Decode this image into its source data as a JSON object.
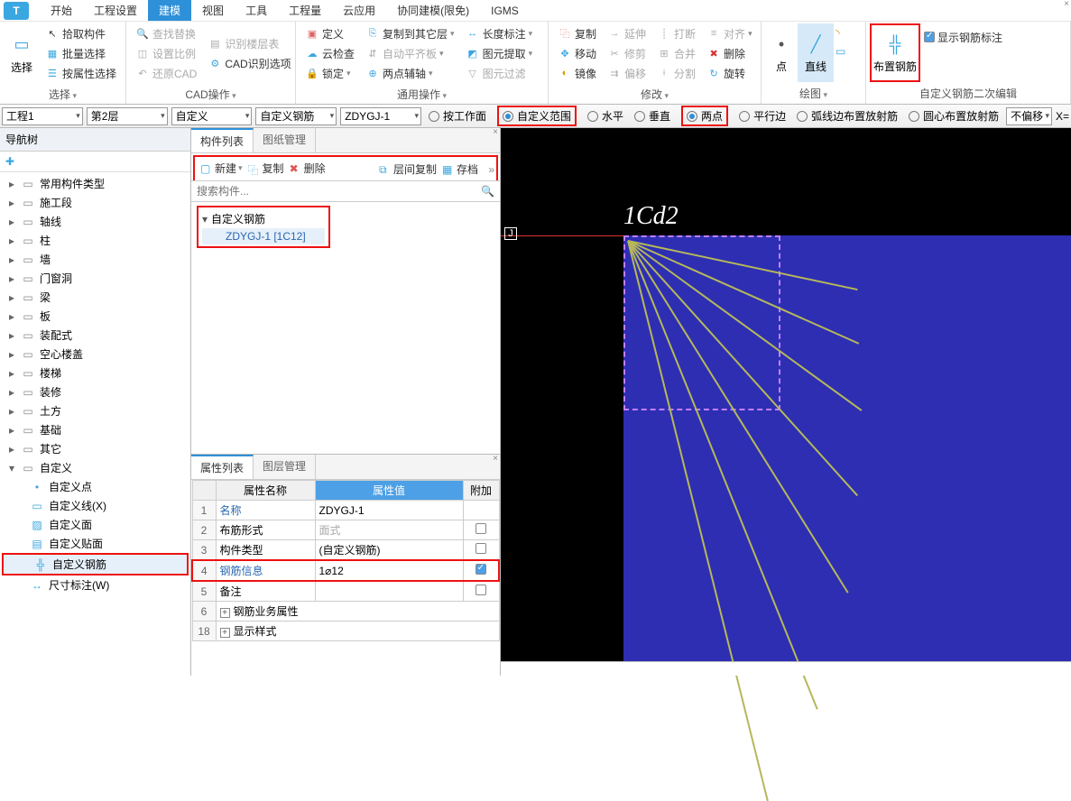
{
  "menubar": {
    "items": [
      "开始",
      "工程设置",
      "建模",
      "视图",
      "工具",
      "工程量",
      "云应用",
      "协同建模(限免)",
      "IGMS"
    ],
    "active_index": 2
  },
  "ribbon": {
    "select_big": "选择",
    "select_group": {
      "pick": "拾取构件",
      "batch": "批量选择",
      "prop": "按属性选择",
      "label": "选择"
    },
    "cad_group": {
      "find": "查找替换",
      "scale": "设置比例",
      "restore": "还原CAD",
      "layers": "识别楼层表",
      "opts": "CAD识别选项",
      "label": "CAD操作"
    },
    "define_group": {
      "define": "定义",
      "cloud": "云检查",
      "lock": "锁定",
      "copylayer": "复制到其它层",
      "align": "自动平齐板",
      "twopt": "两点辅轴",
      "len": "长度标注",
      "extract": "图元提取",
      "filter": "图元过滤",
      "label": "通用操作"
    },
    "modify_group": {
      "copy": "复制",
      "move": "移动",
      "mirror": "镜像",
      "extend": "延伸",
      "trim": "修剪",
      "offset": "偏移",
      "break": "打断",
      "merge": "合并",
      "split": "分割",
      "align2": "对齐",
      "delete": "删除",
      "rotate": "旋转",
      "label": "修改"
    },
    "draw_group": {
      "point": "点",
      "line": "直线",
      "label": "绘图"
    },
    "rebar_group": {
      "place": "布置钢筋",
      "show": "显示钢筋标注",
      "label": "自定义钢筋二次编辑"
    }
  },
  "optbar": {
    "c1": "工程1",
    "c2": "第2层",
    "c3": "自定义",
    "c4": "自定义钢筋",
    "c5": "ZDYGJ-1",
    "r1": "按工作面",
    "r2": "自定义范围",
    "r3": "水平",
    "r4": "垂直",
    "r5": "两点",
    "r6": "平行边",
    "r7": "弧线边布置放射筋",
    "r8": "圆心布置放射筋",
    "c6": "不偏移",
    "c7": "X="
  },
  "nav": {
    "title": "导航树",
    "items": [
      "常用构件类型",
      "施工段",
      "轴线",
      "柱",
      "墙",
      "门窗洞",
      "梁",
      "板",
      "装配式",
      "空心楼盖",
      "楼梯",
      "装修",
      "土方",
      "基础",
      "其它",
      "自定义"
    ],
    "sub": [
      "自定义点",
      "自定义线(X)",
      "自定义面",
      "自定义贴面",
      "自定义钢筋",
      "尺寸标注(W)"
    ],
    "sub_sel_index": 4
  },
  "clist": {
    "tab1": "构件列表",
    "tab2": "图纸管理",
    "btn_new": "新建",
    "btn_copy": "复制",
    "btn_del": "删除",
    "btn_layer": "层间复制",
    "btn_arch": "存档",
    "search_ph": "搜索构件...",
    "group": "自定义钢筋",
    "item": "ZDYGJ-1 [1C12]"
  },
  "props": {
    "tab1": "属性列表",
    "tab2": "图层管理",
    "h_name": "属性名称",
    "h_val": "属性值",
    "h_add": "附加",
    "rows": [
      {
        "n": "1",
        "name": "名称",
        "val": "ZDYGJ-1",
        "link": true,
        "chk": ""
      },
      {
        "n": "2",
        "name": "布筋形式",
        "val": "面式",
        "dim": true,
        "chk": "off"
      },
      {
        "n": "3",
        "name": "构件类型",
        "val": "(自定义钢筋)",
        "chk": "off"
      },
      {
        "n": "4",
        "name": "钢筋信息",
        "val": "1⌀12",
        "link": true,
        "chk": "on"
      },
      {
        "n": "5",
        "name": "备注",
        "val": "",
        "chk": "off"
      },
      {
        "n": "6",
        "name": "钢筋业务属性",
        "val": "",
        "exp": true
      },
      {
        "n": "18",
        "name": "显示样式",
        "val": "",
        "exp": true
      }
    ]
  },
  "canvas": {
    "label": "1Cd2",
    "j": "J"
  }
}
